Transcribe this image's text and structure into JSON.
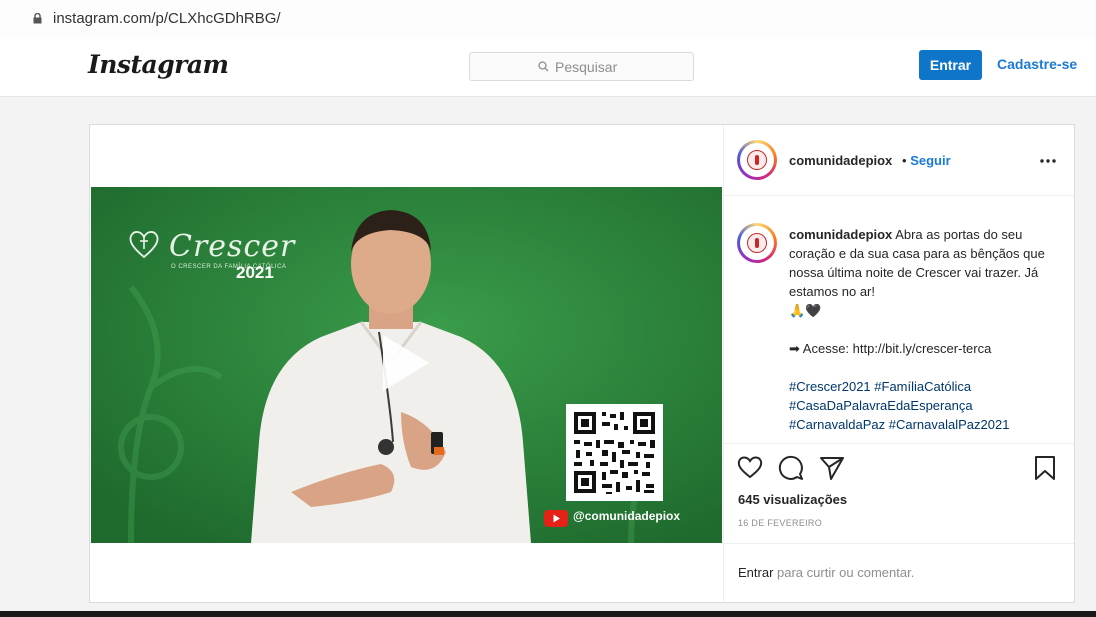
{
  "browser": {
    "url": "instagram.com/p/CLXhcGDhRBG/"
  },
  "header": {
    "logo": "Instagram",
    "search_placeholder": "Pesquisar",
    "login_label": "Entrar",
    "signup_label": "Cadastre-se"
  },
  "post": {
    "username": "comunidadepiox",
    "follow_separator": "•",
    "follow_label": "Seguir",
    "video": {
      "title": "Crescer",
      "subtitle": "O CRESCER DA FAMÍLIA CATÓLICA",
      "year": "2021",
      "handle": "@comunidadepiox"
    },
    "caption": {
      "username": "comunidadepiox",
      "text": "Abra as portas do seu coração e da sua casa para as bênçãos que nossa última noite de Crescer vai trazer. Já estamos no ar!",
      "emoji": "🙏🖤",
      "link_line": "➡ Acesse: http://bit.ly/crescer-terca",
      "hashtags": [
        "#Crescer2021",
        "#FamíliaCatólica",
        "#CasaDaPalavraEdaEsperança",
        "#CarnavaldaPaz",
        "#CarnavalalPaz2021"
      ]
    },
    "views": "645 visualizações",
    "date": "16 DE FEVEREIRO",
    "footer": {
      "login_link": "Entrar",
      "rest": " para curtir ou comentar."
    }
  },
  "colors": {
    "accent": "#0f75c9",
    "link": "#1a7ad6",
    "video_green": "#2f8a3f"
  }
}
